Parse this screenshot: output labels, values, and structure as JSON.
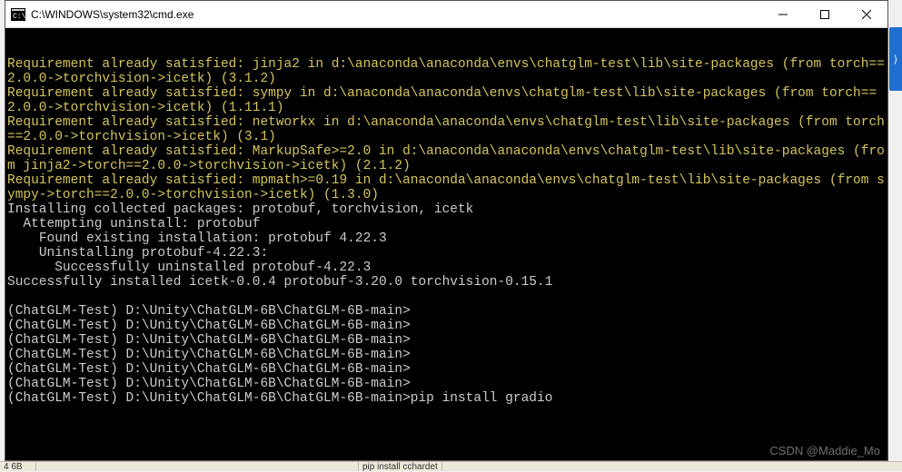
{
  "titlebar": {
    "title": "C:\\WINDOWS\\system32\\cmd.exe"
  },
  "terminal": {
    "lines": [
      {
        "hl": true,
        "text": "Requirement already satisfied: jinja2 in d:\\anaconda\\anaconda\\envs\\chatglm-test\\lib\\site-packages (from torch==2.0.0->torchvision->icetk) (3.1.2)"
      },
      {
        "hl": true,
        "text": "Requirement already satisfied: sympy in d:\\anaconda\\anaconda\\envs\\chatglm-test\\lib\\site-packages (from torch==2.0.0->torchvision->icetk) (1.11.1)"
      },
      {
        "hl": true,
        "text": "Requirement already satisfied: networkx in d:\\anaconda\\anaconda\\envs\\chatglm-test\\lib\\site-packages (from torch==2.0.0->torchvision->icetk) (3.1)"
      },
      {
        "hl": true,
        "text": "Requirement already satisfied: MarkupSafe>=2.0 in d:\\anaconda\\anaconda\\envs\\chatglm-test\\lib\\site-packages (from jinja2->torch==2.0.0->torchvision->icetk) (2.1.2)"
      },
      {
        "hl": true,
        "text": "Requirement already satisfied: mpmath>=0.19 in d:\\anaconda\\anaconda\\envs\\chatglm-test\\lib\\site-packages (from sympy->torch==2.0.0->torchvision->icetk) (1.3.0)"
      },
      {
        "hl": false,
        "text": "Installing collected packages: protobuf, torchvision, icetk"
      },
      {
        "hl": false,
        "text": "  Attempting uninstall: protobuf"
      },
      {
        "hl": false,
        "text": "    Found existing installation: protobuf 4.22.3"
      },
      {
        "hl": false,
        "text": "    Uninstalling protobuf-4.22.3:"
      },
      {
        "hl": false,
        "text": "      Successfully uninstalled protobuf-4.22.3"
      },
      {
        "hl": false,
        "text": "Successfully installed icetk-0.0.4 protobuf-3.20.0 torchvision-0.15.1"
      },
      {
        "hl": false,
        "text": ""
      }
    ],
    "prompts": [
      {
        "prompt": "(ChatGLM-Test) D:\\Unity\\ChatGLM-6B\\ChatGLM-6B-main>",
        "cmd": ""
      },
      {
        "prompt": "(ChatGLM-Test) D:\\Unity\\ChatGLM-6B\\ChatGLM-6B-main>",
        "cmd": ""
      },
      {
        "prompt": "(ChatGLM-Test) D:\\Unity\\ChatGLM-6B\\ChatGLM-6B-main>",
        "cmd": ""
      },
      {
        "prompt": "(ChatGLM-Test) D:\\Unity\\ChatGLM-6B\\ChatGLM-6B-main>",
        "cmd": ""
      },
      {
        "prompt": "(ChatGLM-Test) D:\\Unity\\ChatGLM-6B\\ChatGLM-6B-main>",
        "cmd": ""
      },
      {
        "prompt": "(ChatGLM-Test) D:\\Unity\\ChatGLM-6B\\ChatGLM-6B-main>",
        "cmd": ""
      },
      {
        "prompt": "(ChatGLM-Test) D:\\Unity\\ChatGLM-6B\\ChatGLM-6B-main>",
        "cmd": "pip install gradio"
      }
    ]
  },
  "watermark": "CSDN @Maddie_Mo",
  "bottombar": {
    "left": "4 6B",
    "cmd": "pip install cchardet"
  }
}
